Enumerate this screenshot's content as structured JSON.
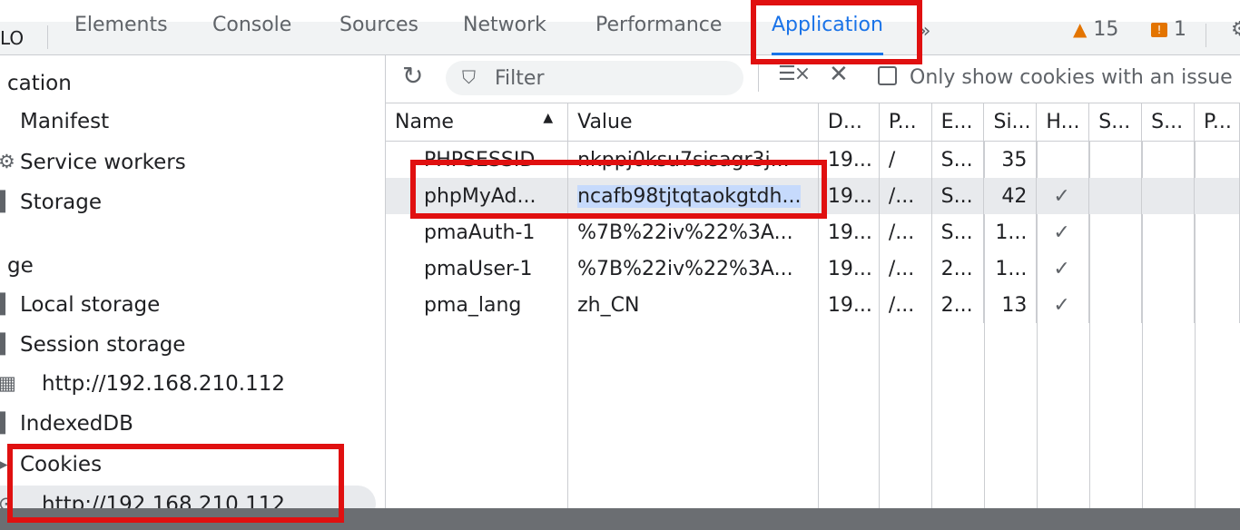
{
  "tabbar": {
    "left_fragment": "LO",
    "tabs": [
      {
        "label": "Elements"
      },
      {
        "label": "Console"
      },
      {
        "label": "Sources"
      },
      {
        "label": "Network"
      },
      {
        "label": "Performance"
      },
      {
        "label": "Application"
      }
    ],
    "active_tab": "Application",
    "more_glyph": "»",
    "warning_count": "15",
    "error_count": "1"
  },
  "sidebar": {
    "section_application": "cation",
    "application_items": [
      {
        "label": "Manifest",
        "icon": "document-icon"
      },
      {
        "label": "Service workers",
        "icon": "gear-icon"
      },
      {
        "label": "Storage",
        "icon": "database-icon"
      }
    ],
    "section_storage": "ge",
    "storage_items": [
      {
        "label": "Local storage",
        "icon": "table-icon"
      },
      {
        "label": "Session storage",
        "icon": "table-icon"
      },
      {
        "label": "http://192.168.210.112",
        "icon": "grid-icon"
      },
      {
        "label": "IndexedDB",
        "icon": "database-icon"
      },
      {
        "label": "Cookies",
        "icon": "cookie-icon"
      },
      {
        "label": "http://192.168.210.112",
        "icon": "cookie-icon"
      }
    ]
  },
  "toolbar": {
    "filter_placeholder": "Filter",
    "only_issues_label": "Only show cookies with an issue"
  },
  "cookies_table": {
    "columns": [
      "Name",
      "Value",
      "D...",
      "P...",
      "E...",
      "Si...",
      "H...",
      "S...",
      "S...",
      "P..."
    ],
    "sorted_by": "Name",
    "rows": [
      {
        "name": "PHPSESSID",
        "value": "nkppj0ksu7sisagr3j...",
        "domain": "19...",
        "path": "/",
        "expires": "S...",
        "size": "35",
        "httponly": ""
      },
      {
        "name": "phpMyAd...",
        "value": "ncafb98tjtqtaokgtdh...",
        "domain": "19...",
        "path": "/...",
        "expires": "S...",
        "size": "42",
        "httponly": "✓"
      },
      {
        "name": "pmaAuth-1",
        "value": "%7B%22iv%22%3A...",
        "domain": "19...",
        "path": "/...",
        "expires": "S...",
        "size": "1...",
        "httponly": "✓"
      },
      {
        "name": "pmaUser-1",
        "value": "%7B%22iv%22%3A...",
        "domain": "19...",
        "path": "/...",
        "expires": "2...",
        "size": "1...",
        "httponly": "✓"
      },
      {
        "name": "pma_lang",
        "value": "zh_CN",
        "domain": "19...",
        "path": "/...",
        "expires": "2...",
        "size": "13",
        "httponly": "✓"
      }
    ],
    "selected_row_index": 1
  },
  "colors": {
    "accent": "#1a73e8",
    "annotation": "#e01010",
    "selection": "#c6dafc",
    "warning": "#e37400"
  }
}
